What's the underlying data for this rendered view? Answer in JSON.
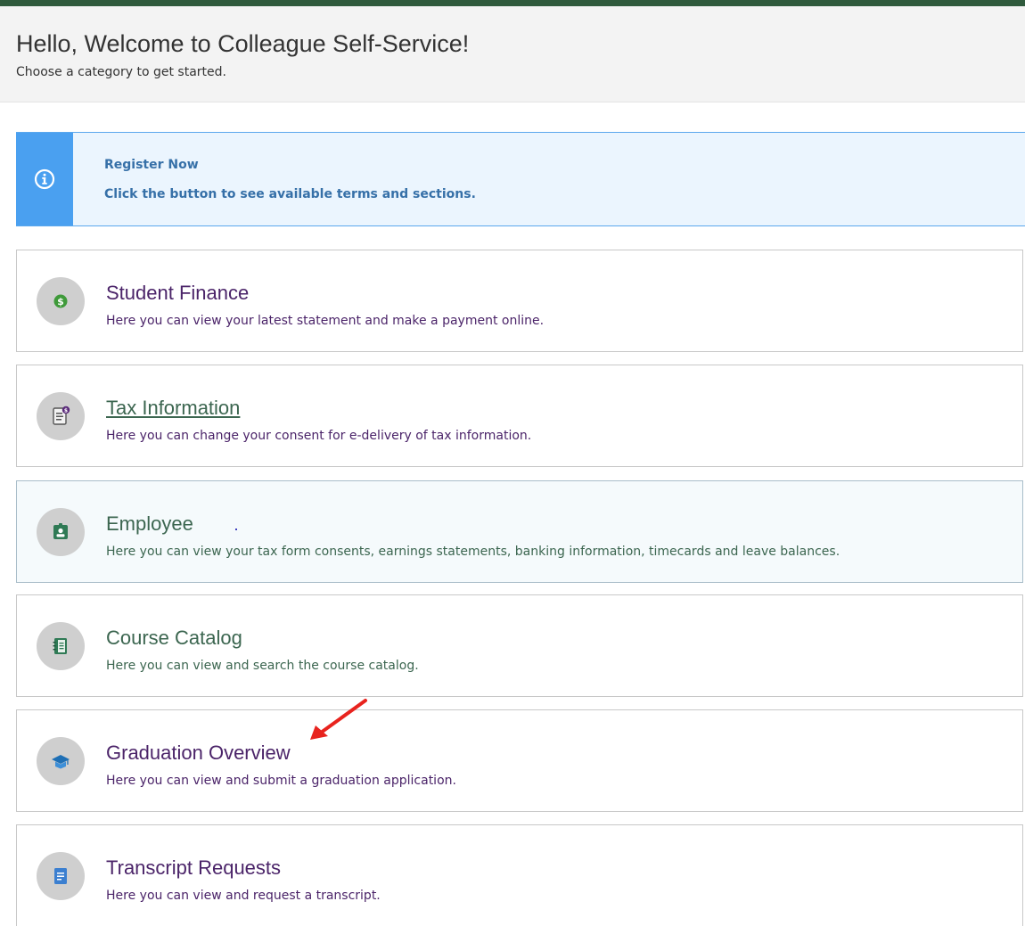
{
  "header": {
    "welcome_title": "Hello, Welcome to Colleague Self-Service!",
    "welcome_subtitle": "Choose a category to get started."
  },
  "notice": {
    "icon": "info-circle-icon",
    "title": "Register Now",
    "text": "Click the button to see available terms and sections."
  },
  "categories": [
    {
      "title": "Student Finance",
      "description": "Here you can view your latest statement and make a payment online.",
      "icon": "dollar-coin-icon"
    },
    {
      "title": "Tax Information",
      "description": "Here you can change your consent for e-delivery of tax information.",
      "icon": "tax-document-icon"
    },
    {
      "title": "Employee",
      "description": "Here you can view your tax form consents, earnings statements, banking information, timecards and leave balances.",
      "icon": "employee-badge-icon"
    },
    {
      "title": "Course Catalog",
      "description": "Here you can view and search the course catalog.",
      "icon": "catalog-book-icon"
    },
    {
      "title": "Graduation Overview",
      "description": "Here you can view and submit a graduation application.",
      "icon": "graduation-cap-icon"
    },
    {
      "title": "Transcript Requests",
      "description": "Here you can view and request a transcript.",
      "icon": "transcript-document-icon"
    }
  ],
  "colors": {
    "header_bar": "#2f5a3c",
    "notice_accent": "#4aa0f0",
    "title_purple": "#4b2469",
    "title_green": "#3c6650",
    "annotation_arrow": "#e8231e"
  }
}
